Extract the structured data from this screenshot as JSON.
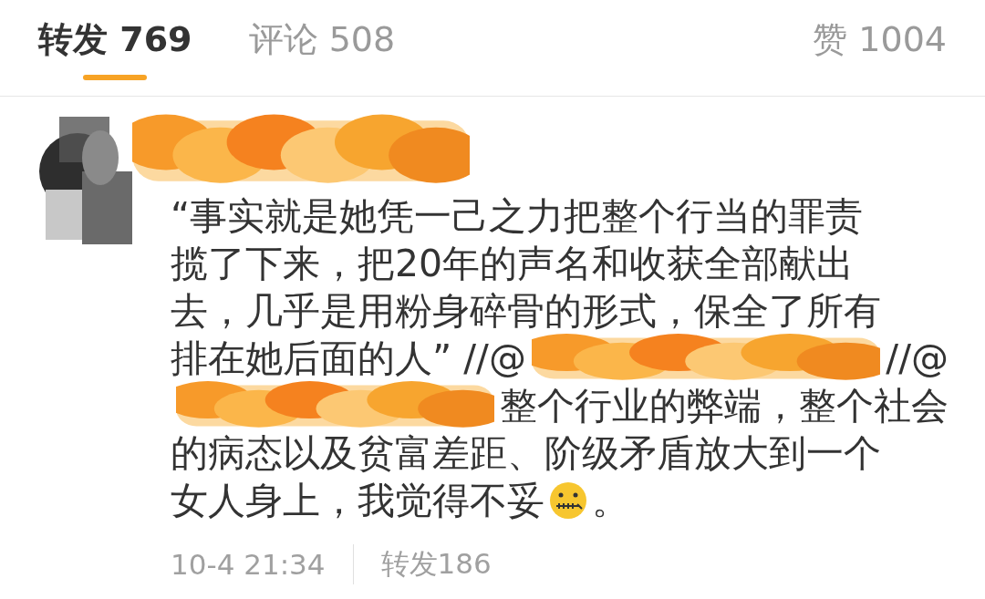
{
  "tabs": [
    {
      "label": "转发 769",
      "selected": true
    },
    {
      "label": "评论 508",
      "selected": false
    },
    {
      "label": "赞 1004",
      "selected": false
    }
  ],
  "post": {
    "lines": [
      [
        {
          "kind": "text",
          "text": "“事实就是她凭一己之力把整个行当的罪责"
        }
      ],
      [
        {
          "kind": "text",
          "text": "揽了下来，把20年的声名和收获全部献出"
        }
      ],
      [
        {
          "kind": "text",
          "text": "去，几乎是用粉身碎骨的形式，保全了所有"
        }
      ],
      [
        {
          "kind": "text",
          "text": "排在她后面的人” //@"
        },
        {
          "kind": "redaction"
        },
        {
          "kind": "text",
          "text": "//@"
        }
      ],
      [
        {
          "kind": "redaction"
        },
        {
          "kind": "text",
          "text": "整个行业的弊端，整个社会"
        }
      ],
      [
        {
          "kind": "text",
          "text": "的病态以及贫富差距、阶级矛盾放大到一个"
        }
      ],
      [
        {
          "kind": "text",
          "text": "女人身上，我觉得不妥"
        },
        {
          "kind": "emoji"
        },
        {
          "kind": "text",
          "text": "。"
        }
      ]
    ],
    "time": "10-4 21:34",
    "reposts": "转发186"
  }
}
